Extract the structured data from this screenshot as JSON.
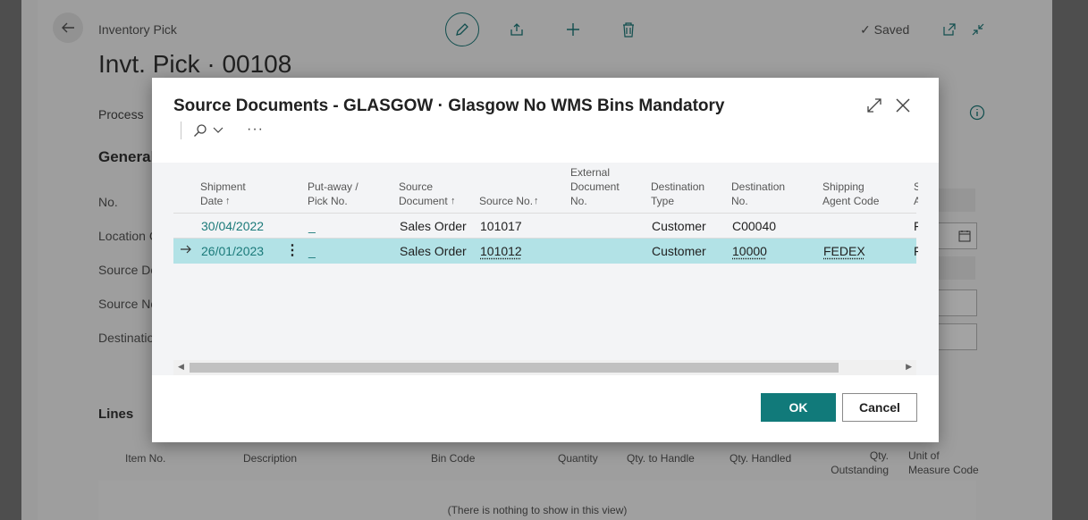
{
  "page": {
    "breadcrumb": "Inventory Pick",
    "title": "Invt. Pick · 00108",
    "saved_label": "Saved",
    "tab_process": "Process",
    "section_general": "General",
    "fields": [
      "No.",
      "Location C",
      "Source Do",
      "Source No",
      "Destinatio"
    ],
    "lines_title": "Lines",
    "lines_columns": [
      "Item No.",
      "Description",
      "Bin Code",
      "Quantity",
      "Qty. to Handle",
      "Qty. Handled",
      "Qty. Outstanding",
      "Unit of Measure Code"
    ],
    "lines_empty": "(There is nothing to show in this view)"
  },
  "dialog": {
    "title": "Source Documents - GLASGOW · Glasgow No WMS Bins Mandatory",
    "columns": [
      {
        "label": "Shipment Date",
        "sort": "↑"
      },
      {
        "label": "Put-away / Pick No.",
        "sort": ""
      },
      {
        "label": "Source Document",
        "sort": "↑"
      },
      {
        "label": "Source No.",
        "sort": "↑"
      },
      {
        "label": "External Document No.",
        "sort": ""
      },
      {
        "label": "Destination Type",
        "sort": ""
      },
      {
        "label": "Destination No.",
        "sort": ""
      },
      {
        "label": "Shipping Agent Code",
        "sort": ""
      },
      {
        "label": "S A",
        "sort": ""
      }
    ],
    "rows": [
      {
        "shipment_date": "30/04/2022",
        "pick_no": "_",
        "source_document": "Sales Order",
        "source_no": "101017",
        "external_doc": "",
        "destination_type": "Customer",
        "destination_no": "C00040",
        "shipping_agent": "",
        "extra": "F",
        "selected": false
      },
      {
        "shipment_date": "26/01/2023",
        "pick_no": "_",
        "source_document": "Sales Order",
        "source_no": "101012",
        "external_doc": "",
        "destination_type": "Customer",
        "destination_no": "10000",
        "shipping_agent": "FEDEX",
        "extra": "F",
        "selected": true
      }
    ],
    "ok_label": "OK",
    "cancel_label": "Cancel"
  },
  "colors": {
    "accent": "#117a7a",
    "selected_row": "#b2e2e6",
    "link": "#1b7a7a"
  }
}
